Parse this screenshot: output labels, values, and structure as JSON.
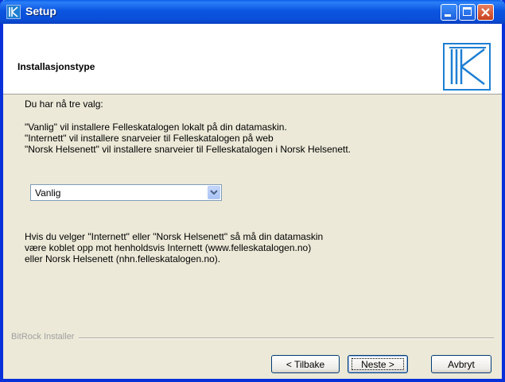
{
  "window": {
    "title": "Setup"
  },
  "header": {
    "title": "Installasjonstype"
  },
  "content": {
    "intro": "Du har nå tre valg:",
    "descriptions": [
      "\"Vanlig\" vil installere Felleskatalogen lokalt på din datamaskin.",
      "\"Internett\" vil installere snarveier til Felleskatalogen på web",
      "\"Norsk Helsenett\" vil installere snarveier til Felleskatalogen i Norsk Helsenett."
    ],
    "install_type": {
      "selected": "Vanlig"
    },
    "note": [
      "Hvis du velger \"Internett\" eller \"Norsk Helsenett\" så må din datamaskin",
      "være koblet opp mot henholdsvis Internett (www.felleskatalogen.no)",
      "eller Norsk Helsenett (nhn.felleskatalogen.no)."
    ]
  },
  "footer": {
    "installer_label": "BitRock Installer",
    "back_label": "< Tilbake",
    "next_label": "Neste >",
    "cancel_label": "Avbryt"
  },
  "colors": {
    "title_bar": "#0a4fd9",
    "face": "#ece9d8",
    "logo_accent": "#1d7fd3",
    "close_button": "#c8401e"
  },
  "icons": [
    "setup-app-icon",
    "minimize-icon",
    "maximize-icon",
    "close-icon",
    "felleskatalogen-logo",
    "dropdown-arrow-icon"
  ]
}
